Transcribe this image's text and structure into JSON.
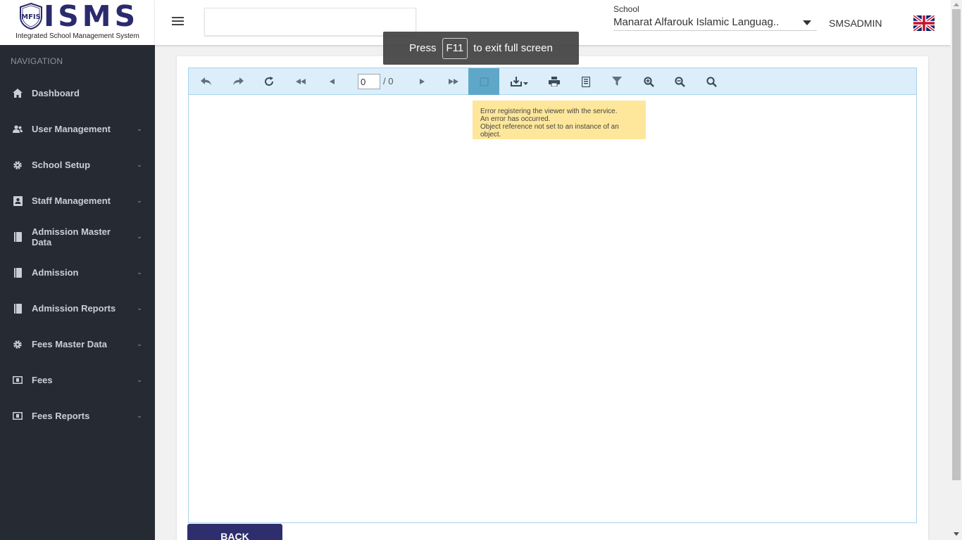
{
  "logo": {
    "title": "ISMS",
    "seal_text": "MFIS",
    "subtitle": "Integrated School Management System"
  },
  "sidebar": {
    "section_title": "NAVIGATION",
    "items": [
      {
        "label": "Dashboard",
        "icon": "home-icon",
        "has_submenu": false
      },
      {
        "label": "User Management",
        "icon": "users-icon",
        "has_submenu": true
      },
      {
        "label": "School Setup",
        "icon": "gear-icon",
        "has_submenu": true
      },
      {
        "label": "Staff Management",
        "icon": "id-card-icon",
        "has_submenu": true
      },
      {
        "label": "Admission Master Data",
        "icon": "book-icon",
        "has_submenu": true
      },
      {
        "label": "Admission",
        "icon": "book-icon",
        "has_submenu": true
      },
      {
        "label": "Admission Reports",
        "icon": "book-icon",
        "has_submenu": true
      },
      {
        "label": "Fees Master Data",
        "icon": "gear-icon",
        "has_submenu": true
      },
      {
        "label": "Fees",
        "icon": "money-icon",
        "has_submenu": true
      },
      {
        "label": "Fees Reports",
        "icon": "money-icon",
        "has_submenu": true
      }
    ]
  },
  "header": {
    "school_label": "School",
    "school_value": "Manarat Alfarouk Islamic Languag..",
    "username": "SMSADMIN",
    "language_flag": "uk-flag-icon"
  },
  "fullscreen_toast": {
    "prefix": "Press",
    "key": "F11",
    "suffix": "to exit full screen"
  },
  "viewer": {
    "page_current": "0",
    "page_total": "/ 0",
    "toolbar_buttons": [
      "back-icon",
      "forward-icon",
      "refresh-icon",
      "first-page-icon",
      "previous-page-icon",
      "next-page-icon",
      "last-page-icon",
      "document-map-icon",
      "export-icon",
      "print-icon",
      "print-preview-icon",
      "parameters-icon",
      "zoom-in-icon",
      "zoom-out-icon",
      "search-icon"
    ],
    "error_lines": [
      "Error registering the viewer with the service.",
      "An error has occurred.",
      "Object reference not set to an instance of an object."
    ]
  },
  "back_button": "BACK",
  "colors": {
    "sidebar_bg": "#262b33",
    "brand": "#2e2e6e",
    "toolbar_bg": "#dbeefa",
    "toolbar_active": "#5fa7c9",
    "error_bg": "#fee79b"
  }
}
